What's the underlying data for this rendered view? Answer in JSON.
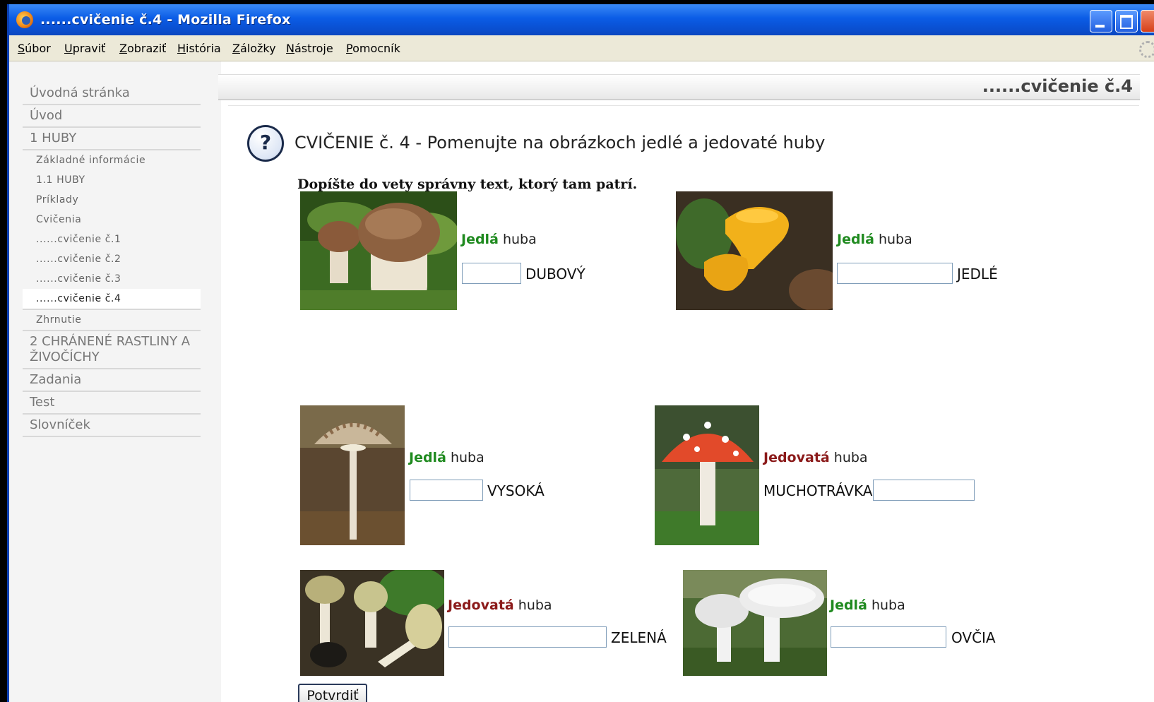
{
  "window": {
    "title": "......cvičenie č.4 - Mozilla Firefox"
  },
  "menu": {
    "items": [
      "Súbor",
      "Upraviť",
      "Zobraziť",
      "História",
      "Záložky",
      "Nástroje",
      "Pomocník"
    ]
  },
  "header": {
    "title": "......cvičenie č.4"
  },
  "sidebar": {
    "items": [
      {
        "label": "Úvodná stránka",
        "level": 1
      },
      {
        "label": "Úvod",
        "level": 1
      },
      {
        "label": "1 HUBY",
        "level": 1
      },
      {
        "label": "Základné informácie",
        "level": 2
      },
      {
        "label": "1.1 HUBY",
        "level": 2
      },
      {
        "label": "Príklady",
        "level": 2
      },
      {
        "label": "Cvičenia",
        "level": 2
      },
      {
        "label": "......cvičenie č.1",
        "level": 2
      },
      {
        "label": "......cvičenie č.2",
        "level": 2
      },
      {
        "label": "......cvičenie č.3",
        "level": 2
      },
      {
        "label": "......cvičenie č.4",
        "level": 2,
        "active": true
      },
      {
        "label": "Zhrnutie",
        "level": 2
      },
      {
        "label": "2 CHRÁNENÉ RASTLINY A ŽIVOČÍCHY",
        "level": 1
      },
      {
        "label": "Zadania",
        "level": 1
      },
      {
        "label": "Test",
        "level": 1
      },
      {
        "label": "Slovníček",
        "level": 1
      }
    ]
  },
  "exercise": {
    "title": "CVIČENIE č. 4 - Pomenujte na obrázkoch jedlé a jedovaté huby",
    "instruction": "Dopíšte do vety správny text, ktorý tam patrí.",
    "submit_label": "Potvrdiť",
    "items": [
      {
        "category": "Jedlá",
        "category_class": "edible",
        "suffix": "huba",
        "word": "DUBOVÝ",
        "word_position": "after"
      },
      {
        "category": "Jedlá",
        "category_class": "edible",
        "suffix": "huba",
        "word": "JEDLÉ",
        "word_position": "after"
      },
      {
        "category": "Jedlá",
        "category_class": "edible",
        "suffix": "huba",
        "word": "VYSOKÁ",
        "word_position": "after"
      },
      {
        "category": "Jedovatá",
        "category_class": "poison",
        "suffix": "huba",
        "word": "MUCHOTRÁVKA",
        "word_position": "before"
      },
      {
        "category": "Jedovatá",
        "category_class": "poison",
        "suffix": "huba",
        "word": "ZELENÁ",
        "word_position": "after"
      },
      {
        "category": "Jedlá",
        "category_class": "edible",
        "suffix": "huba",
        "word": "OVČIA",
        "word_position": "after"
      }
    ]
  },
  "colors": {
    "edible": "#1f8a1f",
    "poison": "#8b1a1a",
    "titlebar": "#0b5ce6"
  }
}
